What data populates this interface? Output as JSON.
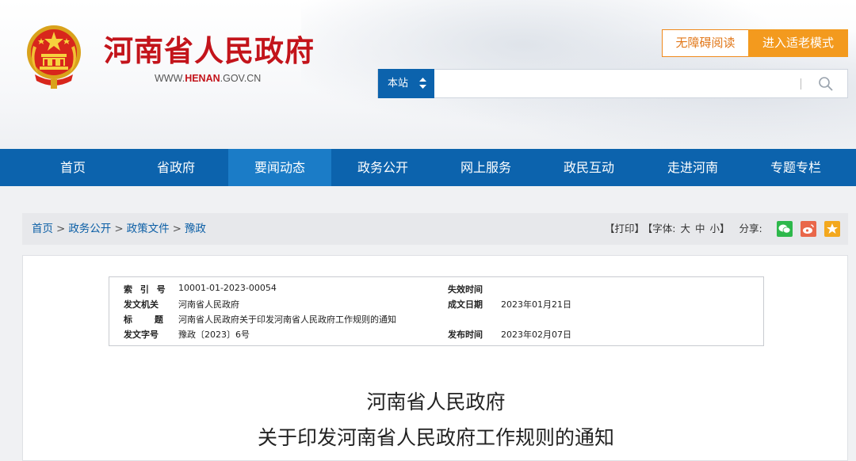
{
  "header": {
    "site_title": "河南省人民政府",
    "site_url_prefix": "WWW.",
    "site_url_host": "HENAN",
    "site_url_suffix": ".GOV.CN",
    "accessibility_label": "无障碍阅读",
    "elder_mode_label": "进入适老模式"
  },
  "search": {
    "scope_label": "本站",
    "placeholder": ""
  },
  "nav": {
    "items": [
      "首页",
      "省政府",
      "要闻动态",
      "政务公开",
      "网上服务",
      "政民互动",
      "走进河南",
      "专题专栏"
    ],
    "active": "要闻动态"
  },
  "breadcrumb": {
    "items": [
      "首页",
      "政务公开",
      "政策文件",
      "豫政"
    ],
    "separator": ">"
  },
  "tools": {
    "print": "【打印】",
    "font_prefix": "【字体:",
    "font_large": "大",
    "font_medium": "中",
    "font_small": "小",
    "font_suffix": "】",
    "share_label": "分享:",
    "share_icons": [
      "wechat-icon",
      "weibo-icon",
      "favorite-icon"
    ]
  },
  "meta": {
    "index_label": "索 引 号",
    "index_value": "10001-01-2023-00054",
    "expire_label": "失效时间",
    "expire_value": "",
    "issuer_label": "发文机关",
    "issuer_value": "河南省人民政府",
    "created_label": "成文日期",
    "created_value": "2023年01月21日",
    "title_label": "标 题",
    "title_value": "河南省人民政府关于印发河南省人民政府工作规则的通知",
    "docno_label": "发文字号",
    "docno_value": "豫政〔2023〕6号",
    "published_label": "发布时间",
    "published_value": "2023年02月07日"
  },
  "document": {
    "title_line1": "河南省人民政府",
    "title_line2": "关于印发河南省人民政府工作规则的通知"
  },
  "colors": {
    "brand_red": "#c3141b",
    "nav_blue": "#0c63ad",
    "active_blue": "#1b7cc7",
    "orange": "#f39a1e"
  }
}
